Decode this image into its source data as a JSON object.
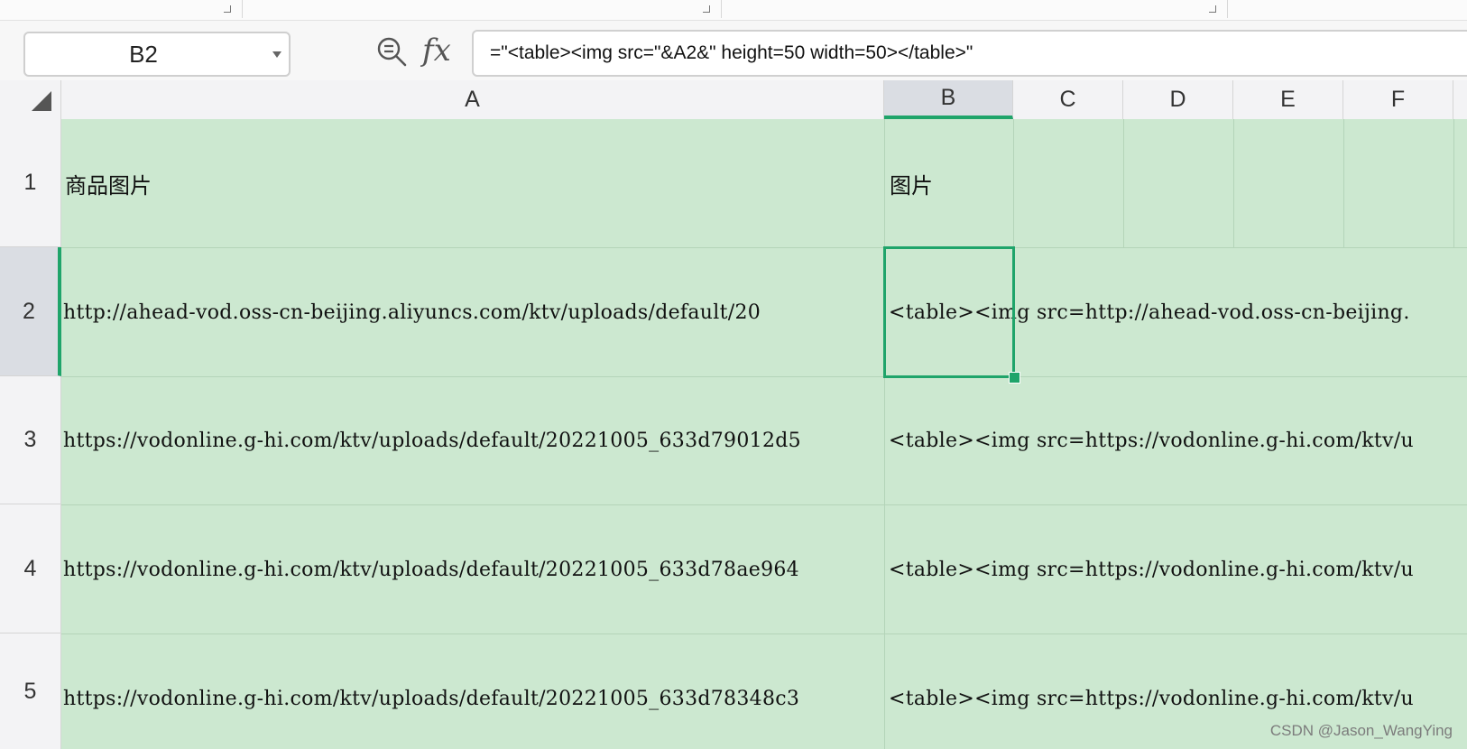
{
  "toolbar": {
    "segments": [
      "",
      "",
      ""
    ]
  },
  "formula_bar": {
    "name_box": "B2",
    "fx_label": "fx",
    "formula": "=\"<table><img src=\"&A2&\" height=50 width=50></table>\""
  },
  "columns": [
    "A",
    "B",
    "C",
    "D",
    "E",
    "F"
  ],
  "rows": [
    {
      "num": "1",
      "a": "商品图片",
      "b": "图片"
    },
    {
      "num": "2",
      "a": "http://ahead-vod.oss-cn-beijing.aliyuncs.com/ktv/uploads/default/20",
      "b": "<table><img src=http://ahead-vod.oss-cn-beijing."
    },
    {
      "num": "3",
      "a": "https://vodonline.g-hi.com/ktv/uploads/default/20221005_633d79012d5",
      "b": "<table><img src=https://vodonline.g-hi.com/ktv/u"
    },
    {
      "num": "4",
      "a": "https://vodonline.g-hi.com/ktv/uploads/default/20221005_633d78ae964",
      "b": "<table><img src=https://vodonline.g-hi.com/ktv/u"
    },
    {
      "num": "5",
      "a": "https://vodonline.g-hi.com/ktv/uploads/default/20221005_633d78348c3",
      "b": "<table><img src=https://vodonline.g-hi.com/ktv/u"
    }
  ],
  "selection": {
    "active_cell": "B2",
    "active_column": "B",
    "active_row": "2"
  },
  "colors": {
    "cell_fill": "#cce8d0",
    "selection": "#1fa46a",
    "header_bg": "#f3f3f5"
  },
  "watermark": "CSDN @Jason_WangYing"
}
